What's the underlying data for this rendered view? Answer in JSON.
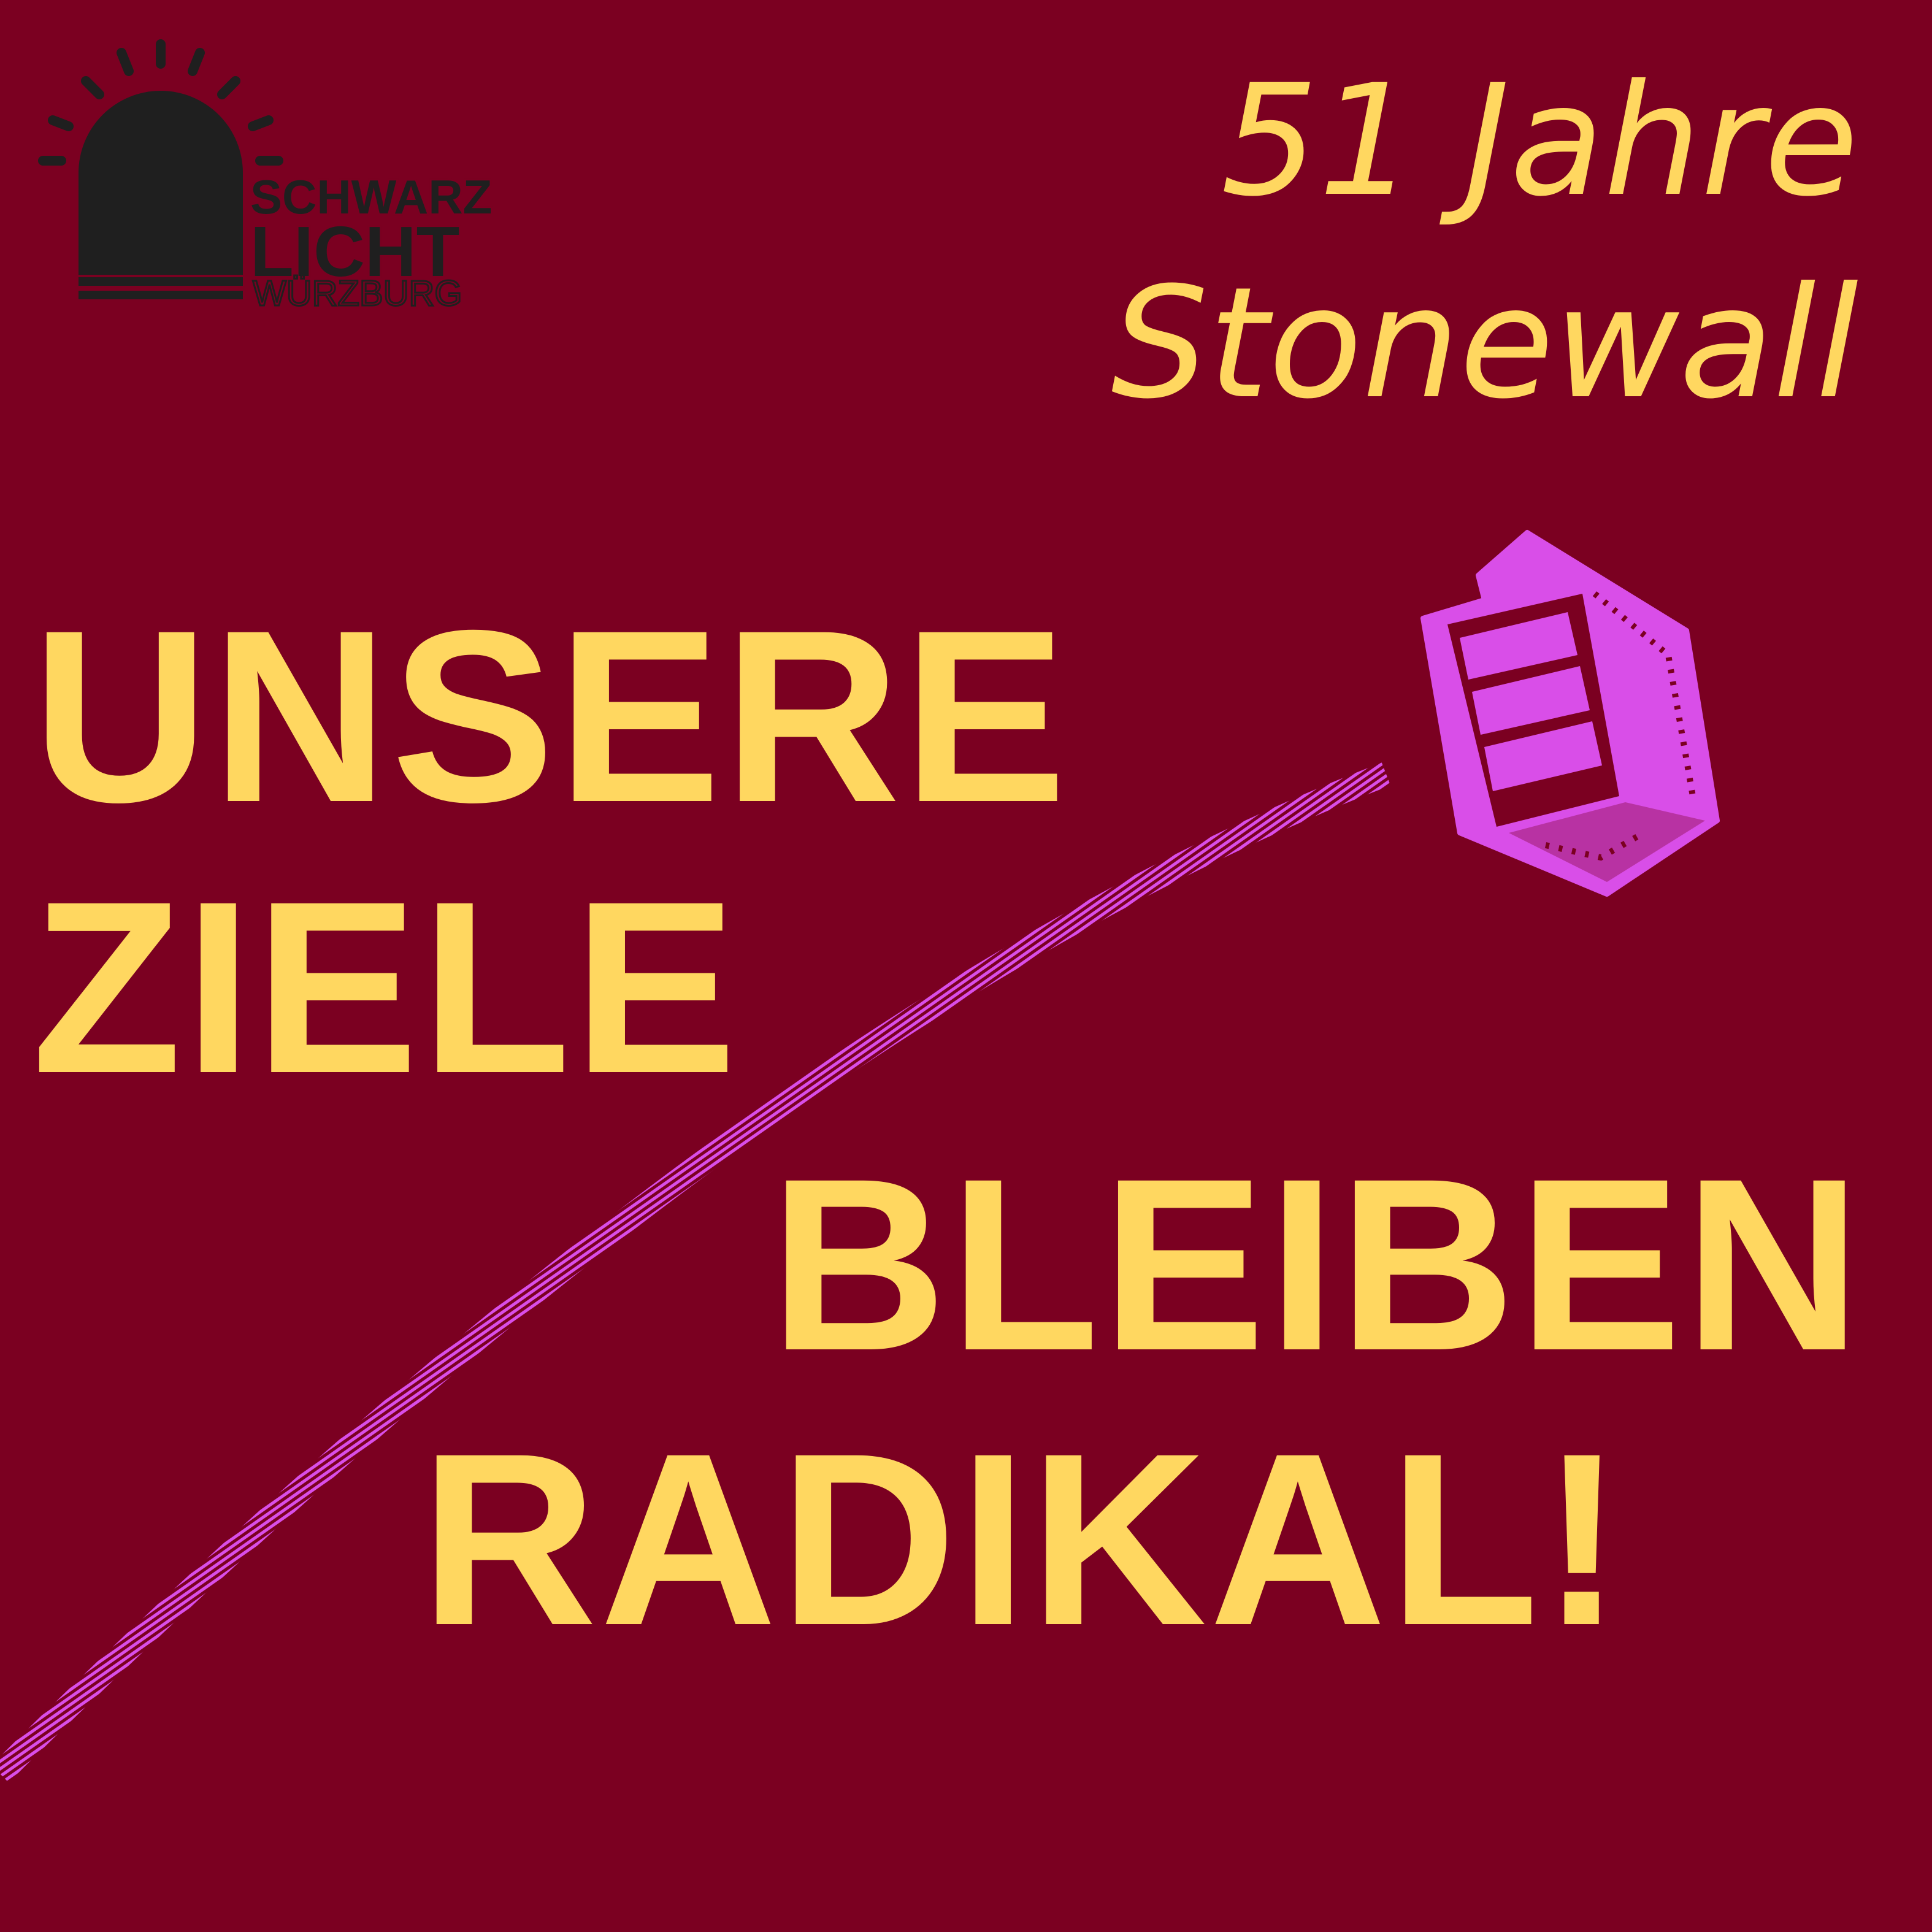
{
  "colors": {
    "background": "#7b0021",
    "text_yellow": "#ffd760",
    "accent_magenta": "#d94ee8",
    "logo_dark": "#1f1f1f"
  },
  "logo": {
    "line1": "SCHWARZ",
    "line2": "LICHT",
    "line3": "WÜRZBURG",
    "icon": "siren-light-icon"
  },
  "anniversary": {
    "line1": "51 Jahre",
    "line2": "Stonewall"
  },
  "headline": {
    "line1": "UNSERE",
    "line2": "ZIELE",
    "line3": "BLEIBEN",
    "line4": "RADIKAL!"
  },
  "illustration": {
    "brick": "brick-icon",
    "trail": "throw-trail"
  }
}
